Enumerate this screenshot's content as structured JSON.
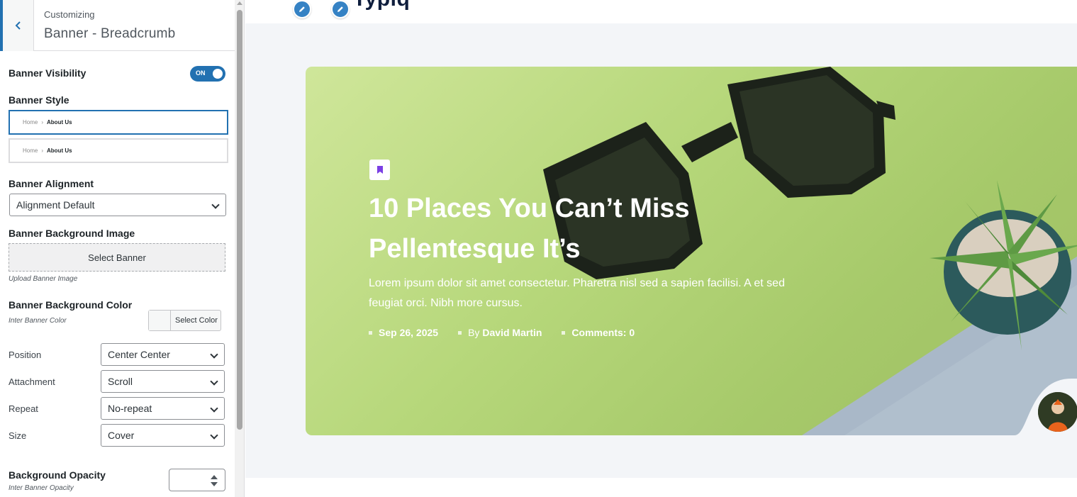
{
  "panel": {
    "subtitle": "Customizing",
    "title": "Banner - Breadcrumb",
    "visibility": {
      "label": "Banner Visibility",
      "toggle_text": "ON",
      "on": true
    },
    "style": {
      "label": "Banner Style",
      "options": [
        {
          "home": "Home",
          "current": "About Us",
          "selected": true
        },
        {
          "home": "Home",
          "current": "About Us",
          "selected": false
        }
      ]
    },
    "alignment": {
      "label": "Banner Alignment",
      "value": "Alignment Default"
    },
    "bg_image": {
      "label": "Banner Background Image",
      "button": "Select Banner",
      "desc": "Upload Banner Image"
    },
    "bg_color": {
      "label": "Banner Background Color",
      "desc": "Inter Banner Color",
      "button": "Select Color"
    },
    "position": {
      "label": "Position",
      "value": "Center Center"
    },
    "attachment": {
      "label": "Attachment",
      "value": "Scroll"
    },
    "repeat": {
      "label": "Repeat",
      "value": "No-repeat"
    },
    "size": {
      "label": "Size",
      "value": "Cover"
    },
    "opacity": {
      "label": "Background Opacity",
      "desc": "Inter Banner Opacity",
      "value": ""
    }
  },
  "preview": {
    "logo_fragment": "Typiq",
    "hero": {
      "title": "10 Places You Can’t Miss Pellentesque It’s",
      "excerpt": "Lorem ipsum dolor sit amet consectetur. Pharetra nisl sed a sapien facilisi. A et sed feugiat orci. Nibh more cursus.",
      "date": "Sep 26, 2025",
      "author_prefix": "By",
      "author": "David Martin",
      "comments": "Comments: 0"
    }
  },
  "colors": {
    "accent": "#2271b1",
    "edit_pen": "#3582c4",
    "hero_green": "#b6d77a",
    "badge_icon": "#7b3fe4"
  },
  "icons": [
    "chevron-left-icon",
    "pencil-icon",
    "bookmark-icon",
    "chevron-down-icon"
  ]
}
